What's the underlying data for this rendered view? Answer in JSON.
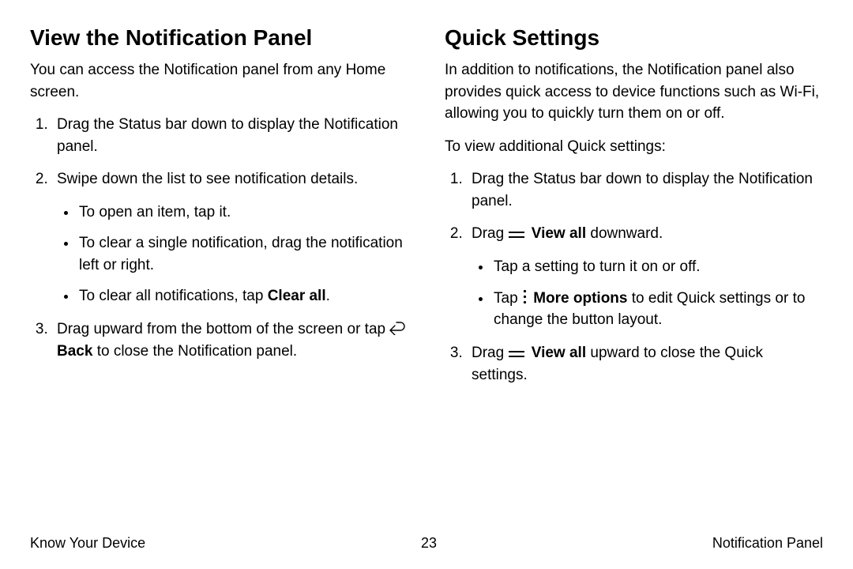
{
  "left": {
    "heading": "View the Notification Panel",
    "intro": "You can access the Notification panel from any Home screen.",
    "step1": "Drag the Status bar down to display the Notification panel.",
    "step2": "Swipe down the list to see notification details.",
    "step2_b1": "To open an item, tap it.",
    "step2_b2": "To clear a single notification, drag the notification left or right.",
    "step2_b3_pre": "To clear all notifications, tap ",
    "step2_b3_bold": "Clear all",
    "step2_b3_post": ".",
    "step3_pre": "Drag upward from the bottom of the screen or tap ",
    "step3_bold": "Back",
    "step3_post": " to close the Notification panel."
  },
  "right": {
    "heading": "Quick Settings",
    "intro": "In addition to notifications, the Notification panel also provides quick access to device functions such as Wi‑Fi, allowing you to quickly turn them on or off.",
    "lead": "To view additional Quick settings:",
    "step1": "Drag the Status bar down to display the Notification panel.",
    "step2_pre": "Drag ",
    "step2_bold": "View all",
    "step2_post": " downward.",
    "step2_b1": "Tap a setting to turn it on or off.",
    "step2_b2_pre": "Tap ",
    "step2_b2_bold": "More options",
    "step2_b2_post": " to edit Quick settings or to change the button layout.",
    "step3_pre": "Drag ",
    "step3_bold": "View all",
    "step3_post": " upward to close the Quick settings."
  },
  "footer": {
    "left": "Know Your Device",
    "center": "23",
    "right": "Notification Panel"
  }
}
